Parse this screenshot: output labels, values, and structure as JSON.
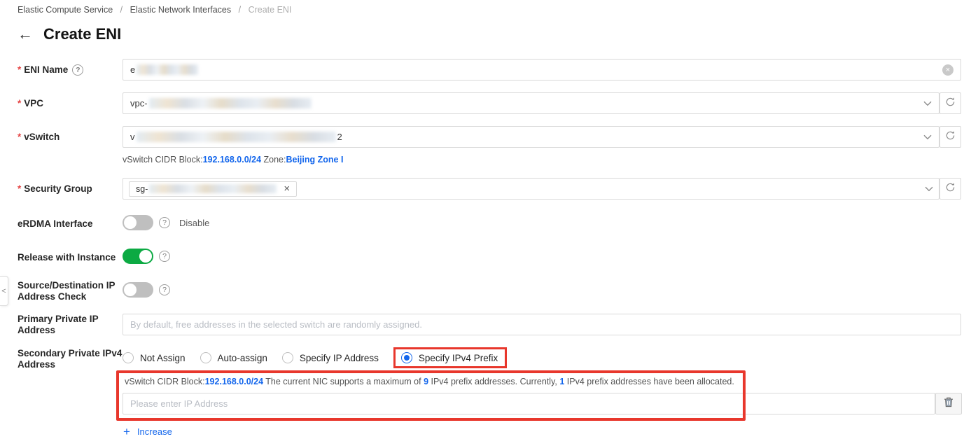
{
  "breadcrumb": {
    "separator": "/",
    "items": [
      {
        "label": "Elastic Compute Service"
      },
      {
        "label": "Elastic Network Interfaces"
      },
      {
        "label": "Create ENI"
      }
    ]
  },
  "header": {
    "back_icon": "←",
    "title": "Create ENI"
  },
  "icons": {
    "help": "?",
    "clear_x": "×",
    "remove_x": "×",
    "collapse_left": "<",
    "plus": "+"
  },
  "form": {
    "required_marker": "*",
    "eni_name": {
      "label": "ENI Name",
      "value_visible": "e"
    },
    "vpc": {
      "label": "VPC",
      "value_visible": "vpc-"
    },
    "vswitch": {
      "label": "vSwitch",
      "value_visible_prefix": "v",
      "value_visible_suffix": "2",
      "info": {
        "cidr_label": "vSwitch CIDR Block:",
        "cidr_value": "192.168.0.0/24",
        "zone_label": " Zone:",
        "zone_value": "Beijing Zone I"
      }
    },
    "security_group": {
      "label": "Security Group",
      "tag_visible": "sg-"
    },
    "erdma_interface": {
      "label": "eRDMA Interface",
      "state": "Disable",
      "toggle_on": false
    },
    "release_with_instance": {
      "label": "Release with Instance",
      "toggle_on": true
    },
    "source_dest_check": {
      "label": "Source/Destination IP Address Check",
      "toggle_on": false
    },
    "primary_private_ip": {
      "label": "Primary Private IP Address",
      "placeholder": "By default, free addresses in the selected switch are randomly assigned."
    },
    "secondary_private_ipv4": {
      "label": "Secondary Private IPv4 Address",
      "options": [
        {
          "label": "Not Assign",
          "selected": false
        },
        {
          "label": "Auto-assign",
          "selected": false
        },
        {
          "label": "Specify IP Address",
          "selected": false
        },
        {
          "label": "Specify IPv4 Prefix",
          "selected": true
        }
      ]
    },
    "prefix_info": {
      "cidr_label": "vSwitch CIDR Block:",
      "cidr_value": "192.168.0.0/24",
      "text_1": "  The current NIC supports a maximum of ",
      "max_count": "9",
      "text_2": " IPv4 prefix addresses. Currently, ",
      "allocated_count": "1",
      "text_3": " IPv4 prefix addresses have been allocated."
    },
    "ip_input": {
      "placeholder": "Please enter IP Address"
    },
    "increase_link": {
      "label": "Increase"
    }
  },
  "colors": {
    "accent_blue": "#1366ec",
    "toggle_on_green": "#0caa43",
    "annotation_red": "#e8372c",
    "required_red": "#e54545"
  }
}
